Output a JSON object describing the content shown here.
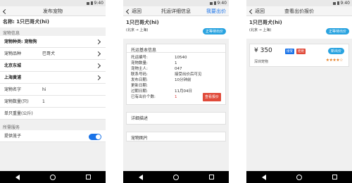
{
  "status": {
    "time": "9:40"
  },
  "screen1": {
    "nav": {
      "back_label": "",
      "title": "发布宠物"
    },
    "name_line": "名称: 1只巴哥犬(hi)",
    "section_info": "宠物信息",
    "rows": [
      {
        "label": "宠物种类: 宠物狗",
        "value": "",
        "arrow": true,
        "bold": true
      },
      {
        "label": "宠物品种",
        "value": "巴哥犬",
        "arrow": true,
        "bold": false
      },
      {
        "label": "北京东城",
        "value": "",
        "arrow": true,
        "bold": true
      },
      {
        "label": "上海黄浦",
        "value": "",
        "arrow": true,
        "bold": true
      },
      {
        "label": "宠物名字",
        "value": "hi",
        "arrow": false,
        "bold": false
      },
      {
        "label": "宠物数量(只)",
        "value": "1",
        "arrow": false,
        "bold": false
      },
      {
        "label": "单只重量(公斤)",
        "value": "",
        "arrow": false,
        "bold": false
      }
    ],
    "section_service": "所需服务",
    "service_row_label": "提供笼子"
  },
  "screen2": {
    "nav": {
      "back_label": "返回",
      "title": "托运详细信息",
      "right_action": "我要出价"
    },
    "item_title": "1只巴哥犬(hi)",
    "route": "(北京 → 上海)",
    "status_badge": "正等待出价",
    "info_header": "托运基本信息",
    "info": [
      {
        "k": "托运编号:",
        "v": "10540",
        "red": false
      },
      {
        "k": "宠物数量:",
        "v": "1",
        "red": false
      },
      {
        "k": "宠物主人:",
        "v": "047",
        "red": false
      },
      {
        "k": "联系号码:",
        "v": "接受出价后可见",
        "red": false
      },
      {
        "k": "发布日期:",
        "v": "10分钟前",
        "red": false
      },
      {
        "k": "更新日期:",
        "v": "",
        "red": false
      },
      {
        "k": "过期日期:",
        "v": "11月04日",
        "red": false
      },
      {
        "k": "已有出价个数:",
        "v": "1",
        "red": true
      }
    ],
    "view_bids_button": "查看报价",
    "detail_header": "详细描述",
    "photos_header": "宠物图片"
  },
  "screen3": {
    "nav": {
      "back_label": "返回",
      "title": "查看出价报价"
    },
    "item_title": "1只巴哥犬(hi)",
    "route": "(北京 → 上海)",
    "status_badge": "正等待出价",
    "bid": {
      "price": "¥ 350",
      "accept_button": "接受",
      "reject_button": "拒绝",
      "new_badge": "新出价",
      "bidder": "深圳宠物",
      "rating_stars": "★★★★☆",
      "rating": 4
    }
  },
  "colors": {
    "accent_blue": "#1a73e8",
    "badge_blue": "#29a3e0",
    "alert_red": "#e04a3a",
    "star_orange": "#e67e22"
  }
}
